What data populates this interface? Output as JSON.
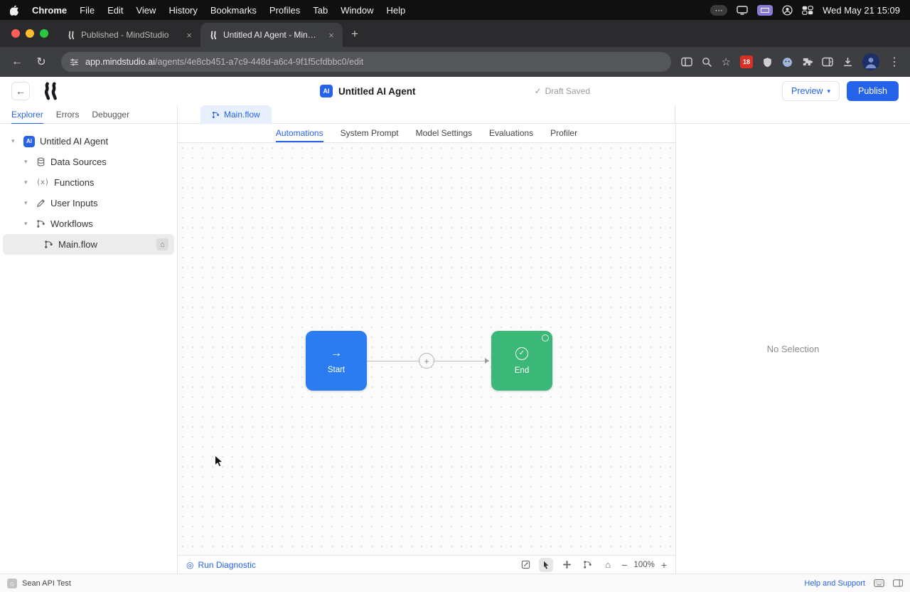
{
  "menubar": {
    "app_name": "Chrome",
    "menus": [
      "File",
      "Edit",
      "View",
      "History",
      "Bookmarks",
      "Profiles",
      "Tab",
      "Window",
      "Help"
    ],
    "clock": "Wed May 21 15:09"
  },
  "browser": {
    "tab_inactive": "Published - MindStudio",
    "tab_active": "Untitled AI Agent - MindStud...",
    "url_domain": "app.mindstudio.ai",
    "url_path": "/agents/4e8cb451-a7c9-448d-a6c4-9f1f5cfdbbc0/edit",
    "extension_badge": "18"
  },
  "header": {
    "ai_badge": "AI",
    "title": "Untitled AI Agent",
    "draft_status": "Draft Saved",
    "preview_button": "Preview",
    "publish_button": "Publish"
  },
  "sidebar": {
    "tabs": [
      "Explorer",
      "Errors",
      "Debugger"
    ],
    "tree": {
      "root_label": "Untitled AI Agent",
      "root_badge": "AI",
      "items": [
        "Data Sources",
        "Functions",
        "User Inputs",
        "Workflows"
      ],
      "workflow_child": "Main.flow"
    }
  },
  "workspace": {
    "flow_tab": "Main.flow",
    "editor_tabs": [
      "Automations",
      "System Prompt",
      "Model Settings",
      "Evaluations",
      "Profiler"
    ]
  },
  "canvas": {
    "start_node": "Start",
    "end_node": "End",
    "run_diagnostic": "Run Diagnostic",
    "zoom_level": "100%"
  },
  "inspector": {
    "empty_state": "No Selection"
  },
  "statusbar": {
    "workspace": "Sean API Test",
    "help": "Help and Support"
  },
  "icons": {
    "close": "×",
    "new_tab": "+",
    "back": "←",
    "reload": "↻",
    "star": "☆",
    "kebab": "⋮",
    "menu_dots": "⋯",
    "chevron_down": "▾",
    "check": "✓",
    "arrow_right": "→",
    "home": "⌂",
    "minus": "−",
    "plus": "+",
    "target": "◎",
    "functions": "(x)"
  },
  "colors": {
    "accent": "#2563eb",
    "start_node": "#2b7cf0",
    "end_node": "#3bb778"
  }
}
